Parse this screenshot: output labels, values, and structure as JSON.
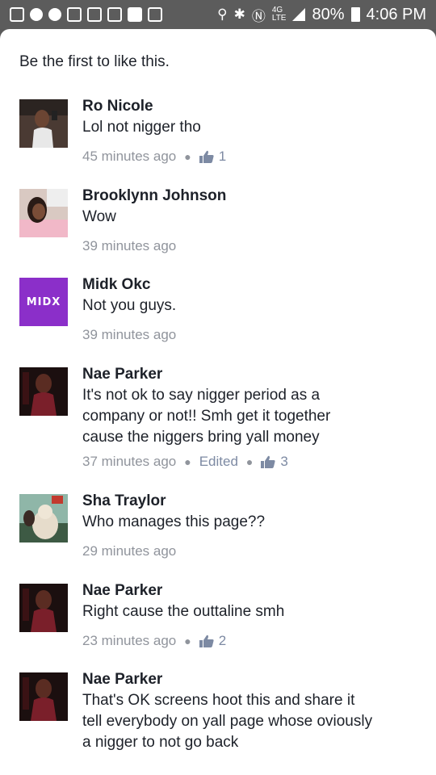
{
  "status_bar": {
    "battery": "80%",
    "time": "4:06 PM",
    "network": "4G",
    "network_sub": "LTE"
  },
  "likes_prompt": "Be the first to like this.",
  "comments": [
    {
      "name": "Ro Nicole",
      "lines": [
        "Lol not nigger tho"
      ],
      "time": "45 minutes ago",
      "likes": "1"
    },
    {
      "name": "Brooklynn Johnson",
      "lines": [
        "Wow"
      ],
      "time": "39 minutes ago"
    },
    {
      "name": "Midk Okc",
      "lines": [
        "Not you guys."
      ],
      "time": "39 minutes ago",
      "avatar_text": "MIDX"
    },
    {
      "name": "Nae Parker",
      "lines": [
        "It's not ok to say nigger period as a",
        "company or not!! Smh get it together",
        "cause the niggers bring yall money"
      ],
      "time": "37 minutes ago",
      "edited": "Edited",
      "likes": "3"
    },
    {
      "name": "Sha Traylor",
      "lines": [
        "Who manages this page??"
      ],
      "time": "29 minutes ago"
    },
    {
      "name": "Nae Parker",
      "lines": [
        "Right cause the outtaline smh"
      ],
      "time": "23 minutes ago",
      "likes": "2"
    },
    {
      "name": "Nae Parker",
      "lines": [
        "That's OK screens hoot this and share it",
        "tell everybody on yall page whose oviously",
        "a nigger to not go back"
      ]
    }
  ],
  "colors": {
    "status_bar": "#5c5c5c",
    "name": "#1d2129",
    "meta": "#90949c",
    "like_accent": "#7d8aa3",
    "midk_avatar": "#8b2fc9"
  }
}
